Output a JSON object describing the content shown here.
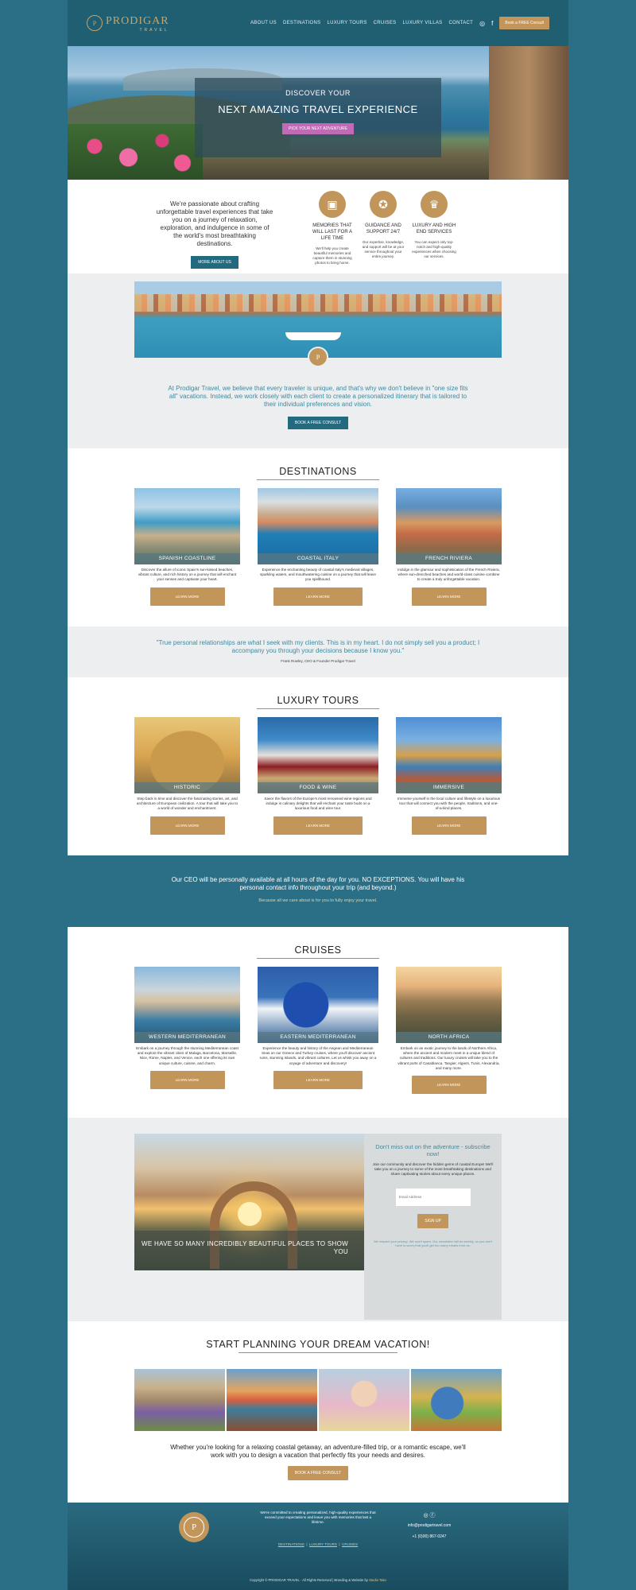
{
  "brand": {
    "name": "PRODIGAR",
    "sub": "TRAVEL",
    "monogram": "P"
  },
  "nav": {
    "items": [
      "ABOUT US",
      "DESTINATIONS",
      "LUXURY TOURS",
      "CRUISES",
      "LUXURY VILLAS",
      "CONTACT"
    ],
    "cta": "Book a FREE Consult",
    "social_icons": [
      "instagram-icon",
      "facebook-icon"
    ]
  },
  "hero": {
    "kicker": "DISCOVER YOUR",
    "headline": "NEXT AMAZING TRAVEL EXPERIENCE",
    "cta": "PICK YOUR NEXT ADVENTURE"
  },
  "about": {
    "text": "We're passionate about crafting unforgettable travel experiences that take you on a journey of relaxation, exploration, and indulgence in some of the world's most breathtaking destinations.",
    "cta": "MORE ABOUT US",
    "features": [
      {
        "icon": "camera-icon",
        "title": "MEMORIES THAT WILL LAST FOR A LIFE TIME",
        "text": "We'll help you create beautiful memories and capture them in stunning photos to bring home."
      },
      {
        "icon": "compass-icon",
        "title": "GUIDANCE AND SUPPORT 24/7",
        "text": "Our expertise, knowledge, and support will be at your service throughout your entire journey."
      },
      {
        "icon": "crown-icon",
        "title": "LUXURY AND HIGH END SERVICES",
        "text": "You can expect only top-notch and high-quality experiences when choosing our services."
      }
    ]
  },
  "belief": {
    "text": "At Prodigar Travel, we believe that every traveler is unique, and that's why we don't believe in \"one size fits all\" vacations. Instead, we work closely with each client to create a personalized itinerary that is tailored to their individual preferences and vision.",
    "cta": "BOOK A FREE CONSULT"
  },
  "destinations": {
    "title": "DESTINATIONS",
    "cards": [
      {
        "label": "SPANISH COASTLINE",
        "text": "Discover the allure of iconic Spain's sun-kissed beaches, vibrant culture, and rich history on a journey that will enchant your senses and captivate your heart.",
        "cta": "LEARN MORE"
      },
      {
        "label": "COASTAL ITALY",
        "text": "Experience the enchanting beauty of coastal Italy's medieval villages, sparkling waters, and mouthwatering cuisine on a journey that will leave you spellbound.",
        "cta": "LEARN MORE"
      },
      {
        "label": "FRENCH RIVIERA",
        "text": "Indulge in the glamour and sophistication of the French Riviera, where sun-drenched beaches and world-class cuisine combine to create a truly unforgettable vacation.",
        "cta": "LEARN MORE"
      }
    ]
  },
  "quote": {
    "text": "\"True personal relationships are what I seek with my clients.  This is in my heart. I do not simply sell you a product; I accompany you through your decisions because I know you.\"",
    "author": "Frank Rowley, CEO & Founder Prodigar Travel"
  },
  "tours": {
    "title": "LUXURY TOURS",
    "cards": [
      {
        "label": "HISTORIC",
        "text": "Step back in time and discover the fascinating stories, art, and architecture of European civilization. A tour that will take you to a world of wonder and enchantment.",
        "cta": "LEARN MORE"
      },
      {
        "label": "FOOD & WINE",
        "text": "Savor the flavors of the Europe's most renowned wine regions and indulge in culinary delights that will enchant your taste buds on a luxurious food and wine tour.",
        "cta": "LEARN MORE"
      },
      {
        "label": "IMMERSIVE",
        "text": "Immerse yourself in the local culture and lifestyle on a luxurious tour that will connect you with the people, traditions, and one-of-a-kind places.",
        "cta": "LEARN MORE"
      }
    ]
  },
  "ceo": {
    "text": "Our CEO will be personally available at all hours of the day for you.  NO EXCEPTIONS.  You will have his personal contact info throughout your trip (and beyond.)",
    "sub": "Because all we care about is for you to fully enjoy your travel."
  },
  "cruises": {
    "title": "CRUISES",
    "cards": [
      {
        "label": "WESTERN MEDITERRANEAN",
        "text": "Embark on a journey through the stunning Mediterranean coast and explore the vibrant cities of Malaga, Barcelona, Marseille, Nice, Rome, Naples, and Venice, each one offering its own unique culture, cuisine, and charm.",
        "cta": "LEARN MORE"
      },
      {
        "label": "EASTERN MEDITERRANEAN",
        "text": "Experience the beauty and history of the Aegean and Mediterranean Seas on our Greece and Turkey cruises, where you'll discover ancient ruins, stunning islands, and vibrant cultures. Let us whisk you away on a voyage of adventure and discovery!",
        "cta": "LEARN MORE"
      },
      {
        "label": "NORTH AFRICA",
        "text": "Embark on an exotic journey to the lands of Northern Africa, where the ancient and modern meet in a unique blend of cultures and traditions. Our luxury cruises will take you to the vibrant ports of Casablanca, Tangier, Algiers, Tunis, Alexandria, and many more.",
        "cta": "LEARN MORE"
      }
    ]
  },
  "subscribe": {
    "image_text": "WE HAVE SO MANY INCREDIBLY BEAUTIFUL PLACES TO SHOW YOU",
    "title": "Don't miss out on the adventure - subscribe now!",
    "text": "Join our community and discover the hidden gems of coastal Europe! We'll take you on a journey to some of the most breathtaking destinations and share captivating stories about every unique places.",
    "placeholder": "Email Address",
    "cta": "SIGN UP",
    "note": "We respect your privacy. We won't spam. Our newsletter will be weekly, so you don't have to worry that you'll get too many emails from us."
  },
  "planning": {
    "title": "START PLANNING YOUR DREAM VACATION!",
    "text": "Whether you're looking for a relaxing coastal getaway, an adventure-filled trip, or a romantic escape, we'll work with you to design a vacation that perfectly fits your needs and desires.",
    "cta": "BOOK A FREE CONSULT"
  },
  "footer": {
    "text": "We're committed to creating personalized, high-quality experiences that exceed your expectations and leave you with memories that last a lifetime.",
    "links": [
      "DESTINATIONS",
      "LUXURY TOURS",
      "CRUISES"
    ],
    "email": "info@prodigartravel.com",
    "phone": "+1 (0)00) 867-0247",
    "copyright": "Copyright © PRODIGAR TRAVEL · All Rights Reserved  |  Branding & Website by",
    "credit": "Studio Tako"
  },
  "colors": {
    "teal": "#2a6f86",
    "gold": "#c2965b",
    "pink": "#c16ab6",
    "light_gray": "#eceeef",
    "quote_teal": "#3f8aa0"
  }
}
